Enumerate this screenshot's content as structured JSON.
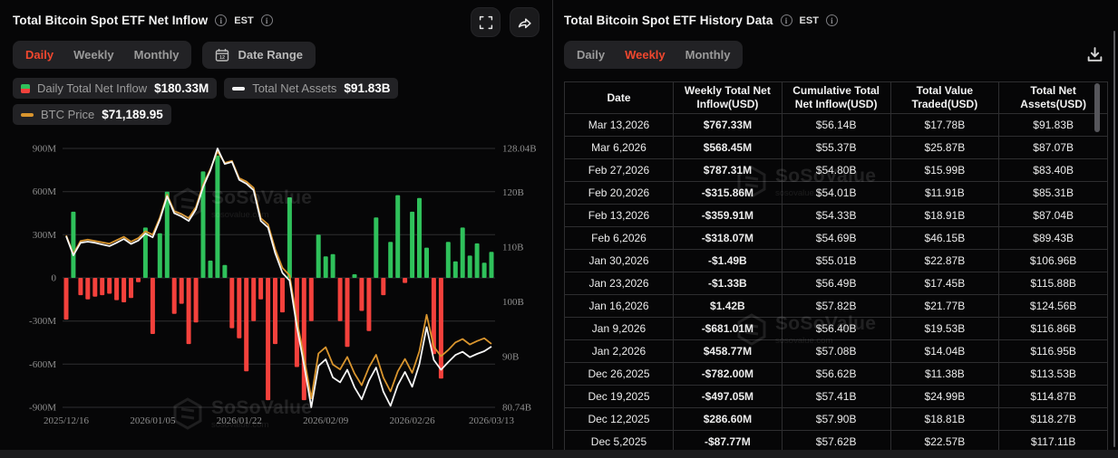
{
  "left_panel": {
    "title": "Total Bitcoin Spot ETF Net Inflow",
    "est_label": "EST",
    "tabs": [
      "Daily",
      "Weekly",
      "Monthly"
    ],
    "active_tab": "Daily",
    "date_range_label": "Date Range",
    "legend": [
      {
        "label": "Daily Total Net Inflow",
        "value": "$180.33M"
      },
      {
        "label": "Total Net Assets",
        "value": "$91.83B"
      },
      {
        "label": "BTC Price",
        "value": "$71,189.95"
      }
    ]
  },
  "right_panel": {
    "title": "Total Bitcoin Spot ETF History Data",
    "est_label": "EST",
    "tabs": [
      "Daily",
      "Weekly",
      "Monthly"
    ],
    "active_tab": "Weekly",
    "table": {
      "columns": [
        "Date",
        "Weekly Total Net Inflow(USD)",
        "Cumulative Total Net Inflow(USD)",
        "Total Value Traded(USD)",
        "Total Net Assets(USD)"
      ],
      "rows": [
        {
          "date": "Mar 13,2026",
          "inflow": "$767.33M",
          "direction": "pos",
          "cumulative": "$56.14B",
          "traded": "$17.78B",
          "assets": "$91.83B"
        },
        {
          "date": "Mar 6,2026",
          "inflow": "$568.45M",
          "direction": "pos",
          "cumulative": "$55.37B",
          "traded": "$25.87B",
          "assets": "$87.07B"
        },
        {
          "date": "Feb 27,2026",
          "inflow": "$787.31M",
          "direction": "pos",
          "cumulative": "$54.80B",
          "traded": "$15.99B",
          "assets": "$83.40B"
        },
        {
          "date": "Feb 20,2026",
          "inflow": "-$315.86M",
          "direction": "neg",
          "cumulative": "$54.01B",
          "traded": "$11.91B",
          "assets": "$85.31B"
        },
        {
          "date": "Feb 13,2026",
          "inflow": "-$359.91M",
          "direction": "neg",
          "cumulative": "$54.33B",
          "traded": "$18.91B",
          "assets": "$87.04B"
        },
        {
          "date": "Feb 6,2026",
          "inflow": "-$318.07M",
          "direction": "neg",
          "cumulative": "$54.69B",
          "traded": "$46.15B",
          "assets": "$89.43B"
        },
        {
          "date": "Jan 30,2026",
          "inflow": "-$1.49B",
          "direction": "neg",
          "cumulative": "$55.01B",
          "traded": "$22.87B",
          "assets": "$106.96B"
        },
        {
          "date": "Jan 23,2026",
          "inflow": "-$1.33B",
          "direction": "neg",
          "cumulative": "$56.49B",
          "traded": "$17.45B",
          "assets": "$115.88B"
        },
        {
          "date": "Jan 16,2026",
          "inflow": "$1.42B",
          "direction": "pos",
          "cumulative": "$57.82B",
          "traded": "$21.77B",
          "assets": "$124.56B"
        },
        {
          "date": "Jan 9,2026",
          "inflow": "-$681.01M",
          "direction": "neg",
          "cumulative": "$56.40B",
          "traded": "$19.53B",
          "assets": "$116.86B"
        },
        {
          "date": "Jan 2,2026",
          "inflow": "$458.77M",
          "direction": "pos",
          "cumulative": "$57.08B",
          "traded": "$14.04B",
          "assets": "$116.95B"
        },
        {
          "date": "Dec 26,2025",
          "inflow": "-$782.00M",
          "direction": "neg",
          "cumulative": "$56.62B",
          "traded": "$11.38B",
          "assets": "$113.53B"
        },
        {
          "date": "Dec 19,2025",
          "inflow": "-$497.05M",
          "direction": "neg",
          "cumulative": "$57.41B",
          "traded": "$24.99B",
          "assets": "$114.87B"
        },
        {
          "date": "Dec 12,2025",
          "inflow": "$286.60M",
          "direction": "pos",
          "cumulative": "$57.90B",
          "traded": "$18.81B",
          "assets": "$118.27B"
        },
        {
          "date": "Dec 5,2025",
          "inflow": "-$87.77M",
          "direction": "neg",
          "cumulative": "$57.62B",
          "traded": "$22.57B",
          "assets": "$117.11B"
        }
      ]
    }
  },
  "watermark": {
    "brand": "SoSoValue",
    "domain": "sosovalue.com"
  },
  "colors": {
    "accent": "#f0472e",
    "positive": "#2fc15b",
    "negative": "#f4413c",
    "assets_line": "#f5f5f5",
    "btc_line": "#d9952e",
    "grid": "#2e2e30",
    "axis_text": "#8f8f8f"
  },
  "chart_data": {
    "type": "bar+line",
    "title": "Total Bitcoin Spot ETF Net Inflow (Daily)",
    "x_ticks": [
      {
        "label": "2025/12/16",
        "index": 0
      },
      {
        "label": "2026/01/05",
        "index": 12
      },
      {
        "label": "2026/01/22",
        "index": 24
      },
      {
        "label": "2026/02/09",
        "index": 36
      },
      {
        "label": "2026/02/26",
        "index": 48
      },
      {
        "label": "2026/03/13",
        "index": 59
      }
    ],
    "left_axis": {
      "unit": "USD (M)",
      "min": -900,
      "max": 900,
      "tick_values": [
        900,
        600,
        300,
        0,
        -300,
        -600,
        -900
      ],
      "tick_labels": [
        "900M",
        "600M",
        "300M",
        "0",
        "-300M",
        "-600M",
        "-900M"
      ]
    },
    "right_axis": {
      "unit": "USD (B)",
      "min": 80.74,
      "max": 128.04,
      "tick_values": [
        128.04,
        120,
        110,
        100,
        90,
        80.74
      ],
      "tick_labels": [
        "128.04B",
        "120B",
        "110B",
        "100B",
        "90B",
        "80.74B"
      ]
    },
    "series": [
      {
        "name": "Daily Total Net Inflow",
        "type": "bar",
        "unit": "$M",
        "axis": "left",
        "latest": 180.33,
        "values": [
          -290,
          460,
          -120,
          -150,
          -130,
          -120,
          -110,
          -155,
          -170,
          -140,
          -30,
          350,
          -390,
          310,
          600,
          -250,
          -180,
          -460,
          -310,
          740,
          120,
          850,
          90,
          -350,
          -420,
          -650,
          -300,
          -150,
          -850,
          -460,
          -240,
          560,
          -620,
          -850,
          -300,
          300,
          150,
          165,
          -300,
          -480,
          25,
          -230,
          -370,
          420,
          -120,
          250,
          575,
          -35,
          460,
          555,
          210,
          -530,
          -700,
          250,
          115,
          350,
          155,
          240,
          105,
          180.33
        ]
      },
      {
        "name": "Total Net Assets",
        "type": "line",
        "unit": "$B",
        "axis": "right",
        "latest": 91.83,
        "values": [
          112.0,
          108.5,
          110.8,
          111.0,
          110.8,
          110.5,
          110.2,
          110.8,
          111.5,
          110.6,
          111.2,
          112.5,
          111.8,
          115.0,
          119.3,
          116.2,
          115.6,
          114.8,
          116.9,
          121.0,
          124.0,
          128.04,
          125.2,
          125.6,
          122.3,
          121.6,
          120.4,
          114.8,
          113.6,
          108.9,
          105.3,
          103.9,
          95.5,
          88.5,
          80.74,
          88.3,
          89.5,
          86.2,
          85.3,
          87.6,
          84.4,
          82.2,
          85.6,
          88.0,
          83.6,
          81.0,
          84.8,
          87.2,
          84.5,
          88.6,
          95.4,
          89.4,
          87.6,
          89.0,
          90.3,
          90.9,
          89.9,
          90.5,
          91.0,
          91.83
        ]
      },
      {
        "name": "BTC Price",
        "type": "line",
        "unit": "$",
        "axis": "hidden",
        "latest": 71189.95,
        "scale_range": [
          62000,
          99500
        ],
        "values": [
          86900,
          84200,
          86100,
          86300,
          86100,
          85900,
          85700,
          86200,
          86700,
          86000,
          86500,
          87500,
          87000,
          89500,
          92800,
          90400,
          90000,
          89400,
          91000,
          94200,
          96500,
          99100,
          97400,
          97700,
          95200,
          94700,
          93800,
          89400,
          88500,
          84900,
          82200,
          81100,
          74600,
          69300,
          63300,
          69800,
          70700,
          68200,
          67500,
          69300,
          66900,
          65200,
          67800,
          69600,
          66300,
          64300,
          67200,
          69000,
          67000,
          70100,
          75400,
          70800,
          69400,
          70300,
          71400,
          71900,
          71100,
          71600,
          72000,
          71189.95
        ]
      }
    ],
    "grid": true,
    "legend_position": "top-left"
  }
}
